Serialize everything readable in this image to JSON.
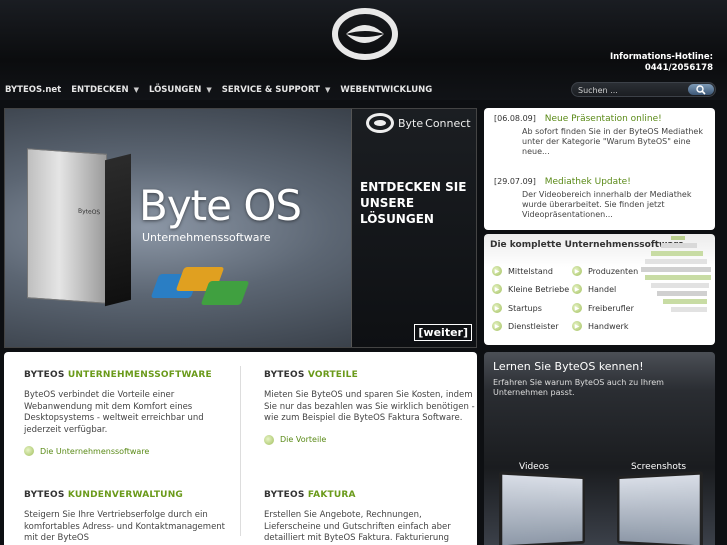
{
  "header": {
    "hotline_label": "Informations-Hotline:",
    "hotline_number": "0441/2056178"
  },
  "nav": {
    "items": [
      {
        "label": "BYTEOS.net",
        "dropdown": false
      },
      {
        "label": "ENTDECKEN",
        "dropdown": true
      },
      {
        "label": "LÖSUNGEN",
        "dropdown": true
      },
      {
        "label": "SERVICE & SUPPORT",
        "dropdown": true
      },
      {
        "label": "WEBENTWICKLUNG",
        "dropdown": false
      }
    ]
  },
  "search": {
    "placeholder": "Suchen ...",
    "icon": "search-icon"
  },
  "hero": {
    "title": "Byte OS",
    "subtitle": "Unternehmenssoftware",
    "box_label": "ByteOS",
    "panel_brand_a": "Byte",
    "panel_brand_b": "Connect",
    "panel_line1": "ENTDECKEN SIE",
    "panel_line2": "UNSERE",
    "panel_line3": "LÖSUNGEN",
    "weiter": "[weiter]"
  },
  "news": [
    {
      "date": "[06.08.09]",
      "headline": "Neue Präsentation online!",
      "text": "Ab sofort finden Sie in der ByteOS Mediathek unter der Kategorie \"Warum ByteOS\" eine neue..."
    },
    {
      "date": "[29.07.09]",
      "headline": "Mediathek Update!",
      "text": "Der Videobereich innerhalb der Mediathek wurde überarbeitet. Sie finden jetzt Videopräsentationen..."
    }
  ],
  "software": {
    "title": "Die komplette Unternehmenssoftware",
    "left": [
      "Mittelstand",
      "Kleine Betriebe",
      "Startups",
      "Dienstleister"
    ],
    "right": [
      "Produzenten",
      "Handel",
      "Freiberufler",
      "Handwerk"
    ]
  },
  "learn": {
    "title": "Lernen Sie ByteOS kennen!",
    "text": "Erfahren Sie warum ByteOS auch zu Ihrem Unternehmen passt.",
    "videos": "Videos",
    "screenshots": "Screenshots"
  },
  "sections": [
    {
      "prefix": "BYTEOS",
      "title": "UNTERNEHMENSSOFTWARE",
      "text": "ByteOS verbindet die Vorteile einer Webanwendung mit dem Komfort eines Desktopsystems - weltweit erreichbar und jederzeit verfügbar.",
      "link": "Die Unternehmenssoftware"
    },
    {
      "prefix": "BYTEOS",
      "title": "VORTEILE",
      "text": "Mieten Sie ByteOS und sparen Sie Kosten, indem Sie nur das bezahlen was Sie wirklich benötigen - wie zum Beispiel die ByteOS Faktura Software.",
      "link": "Die Vorteile"
    },
    {
      "prefix": "BYTEOS",
      "title": "KUNDENVERWALTUNG",
      "text": "Steigern Sie Ihre Vertriebserfolge durch ein komfortables Adress- und Kontaktmanagement mit der ByteOS"
    },
    {
      "prefix": "BYTEOS",
      "title": "FAKTURA",
      "text": "Erstellen Sie Angebote, Rechnungen, Lieferscheine und Gutschriften einfach aber detailliert mit ByteOS Faktura. Fakturierung"
    }
  ]
}
